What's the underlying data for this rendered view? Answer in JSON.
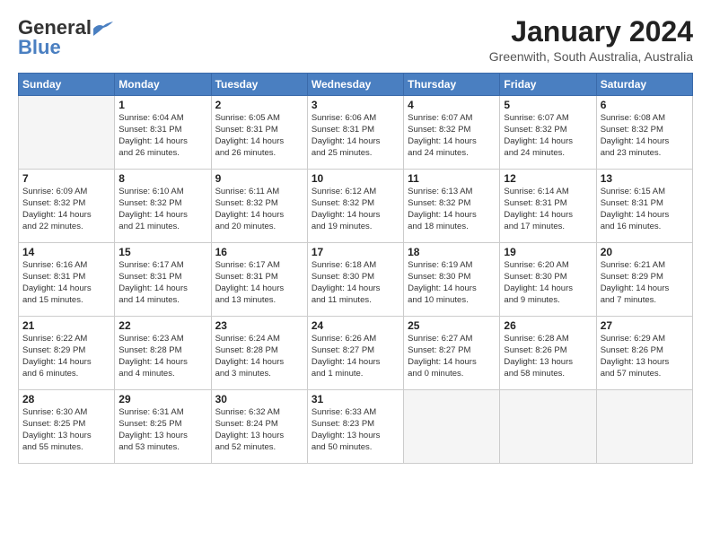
{
  "header": {
    "logo_general": "General",
    "logo_blue": "Blue",
    "title": "January 2024",
    "subtitle": "Greenwith, South Australia, Australia"
  },
  "weekdays": [
    "Sunday",
    "Monday",
    "Tuesday",
    "Wednesday",
    "Thursday",
    "Friday",
    "Saturday"
  ],
  "weeks": [
    [
      {
        "day": "",
        "info": ""
      },
      {
        "day": "1",
        "info": "Sunrise: 6:04 AM\nSunset: 8:31 PM\nDaylight: 14 hours\nand 26 minutes."
      },
      {
        "day": "2",
        "info": "Sunrise: 6:05 AM\nSunset: 8:31 PM\nDaylight: 14 hours\nand 26 minutes."
      },
      {
        "day": "3",
        "info": "Sunrise: 6:06 AM\nSunset: 8:31 PM\nDaylight: 14 hours\nand 25 minutes."
      },
      {
        "day": "4",
        "info": "Sunrise: 6:07 AM\nSunset: 8:32 PM\nDaylight: 14 hours\nand 24 minutes."
      },
      {
        "day": "5",
        "info": "Sunrise: 6:07 AM\nSunset: 8:32 PM\nDaylight: 14 hours\nand 24 minutes."
      },
      {
        "day": "6",
        "info": "Sunrise: 6:08 AM\nSunset: 8:32 PM\nDaylight: 14 hours\nand 23 minutes."
      }
    ],
    [
      {
        "day": "7",
        "info": "Sunrise: 6:09 AM\nSunset: 8:32 PM\nDaylight: 14 hours\nand 22 minutes."
      },
      {
        "day": "8",
        "info": "Sunrise: 6:10 AM\nSunset: 8:32 PM\nDaylight: 14 hours\nand 21 minutes."
      },
      {
        "day": "9",
        "info": "Sunrise: 6:11 AM\nSunset: 8:32 PM\nDaylight: 14 hours\nand 20 minutes."
      },
      {
        "day": "10",
        "info": "Sunrise: 6:12 AM\nSunset: 8:32 PM\nDaylight: 14 hours\nand 19 minutes."
      },
      {
        "day": "11",
        "info": "Sunrise: 6:13 AM\nSunset: 8:32 PM\nDaylight: 14 hours\nand 18 minutes."
      },
      {
        "day": "12",
        "info": "Sunrise: 6:14 AM\nSunset: 8:31 PM\nDaylight: 14 hours\nand 17 minutes."
      },
      {
        "day": "13",
        "info": "Sunrise: 6:15 AM\nSunset: 8:31 PM\nDaylight: 14 hours\nand 16 minutes."
      }
    ],
    [
      {
        "day": "14",
        "info": "Sunrise: 6:16 AM\nSunset: 8:31 PM\nDaylight: 14 hours\nand 15 minutes."
      },
      {
        "day": "15",
        "info": "Sunrise: 6:17 AM\nSunset: 8:31 PM\nDaylight: 14 hours\nand 14 minutes."
      },
      {
        "day": "16",
        "info": "Sunrise: 6:17 AM\nSunset: 8:31 PM\nDaylight: 14 hours\nand 13 minutes."
      },
      {
        "day": "17",
        "info": "Sunrise: 6:18 AM\nSunset: 8:30 PM\nDaylight: 14 hours\nand 11 minutes."
      },
      {
        "day": "18",
        "info": "Sunrise: 6:19 AM\nSunset: 8:30 PM\nDaylight: 14 hours\nand 10 minutes."
      },
      {
        "day": "19",
        "info": "Sunrise: 6:20 AM\nSunset: 8:30 PM\nDaylight: 14 hours\nand 9 minutes."
      },
      {
        "day": "20",
        "info": "Sunrise: 6:21 AM\nSunset: 8:29 PM\nDaylight: 14 hours\nand 7 minutes."
      }
    ],
    [
      {
        "day": "21",
        "info": "Sunrise: 6:22 AM\nSunset: 8:29 PM\nDaylight: 14 hours\nand 6 minutes."
      },
      {
        "day": "22",
        "info": "Sunrise: 6:23 AM\nSunset: 8:28 PM\nDaylight: 14 hours\nand 4 minutes."
      },
      {
        "day": "23",
        "info": "Sunrise: 6:24 AM\nSunset: 8:28 PM\nDaylight: 14 hours\nand 3 minutes."
      },
      {
        "day": "24",
        "info": "Sunrise: 6:26 AM\nSunset: 8:27 PM\nDaylight: 14 hours\nand 1 minute."
      },
      {
        "day": "25",
        "info": "Sunrise: 6:27 AM\nSunset: 8:27 PM\nDaylight: 14 hours\nand 0 minutes."
      },
      {
        "day": "26",
        "info": "Sunrise: 6:28 AM\nSunset: 8:26 PM\nDaylight: 13 hours\nand 58 minutes."
      },
      {
        "day": "27",
        "info": "Sunrise: 6:29 AM\nSunset: 8:26 PM\nDaylight: 13 hours\nand 57 minutes."
      }
    ],
    [
      {
        "day": "28",
        "info": "Sunrise: 6:30 AM\nSunset: 8:25 PM\nDaylight: 13 hours\nand 55 minutes."
      },
      {
        "day": "29",
        "info": "Sunrise: 6:31 AM\nSunset: 8:25 PM\nDaylight: 13 hours\nand 53 minutes."
      },
      {
        "day": "30",
        "info": "Sunrise: 6:32 AM\nSunset: 8:24 PM\nDaylight: 13 hours\nand 52 minutes."
      },
      {
        "day": "31",
        "info": "Sunrise: 6:33 AM\nSunset: 8:23 PM\nDaylight: 13 hours\nand 50 minutes."
      },
      {
        "day": "",
        "info": ""
      },
      {
        "day": "",
        "info": ""
      },
      {
        "day": "",
        "info": ""
      }
    ]
  ]
}
